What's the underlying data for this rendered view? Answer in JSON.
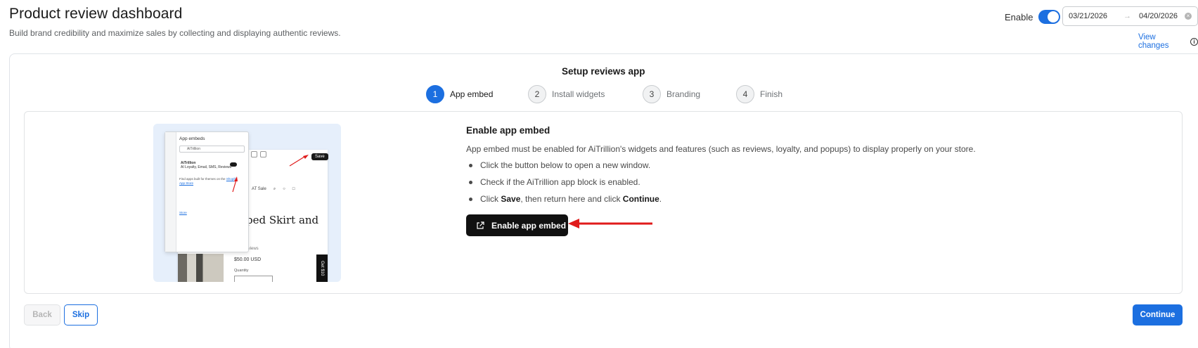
{
  "header": {
    "title": "Product review dashboard",
    "subtitle": "Build brand credibility and maximize sales by collecting and displaying authentic reviews.",
    "enable_label": "Enable",
    "enabled": true,
    "date_start": "03/21/2026",
    "date_end": "04/20/2026",
    "date_arrow": "→",
    "view_changes": "View changes"
  },
  "setup": {
    "title": "Setup reviews app",
    "steps": [
      {
        "num": "1",
        "label": "App embed",
        "active": true
      },
      {
        "num": "2",
        "label": "Install widgets",
        "active": false
      },
      {
        "num": "3",
        "label": "Branding",
        "active": false
      },
      {
        "num": "4",
        "label": "Finish",
        "active": false
      }
    ]
  },
  "illustration": {
    "panel_title": "App embeds",
    "search_text": "AiTrillion",
    "item_title": "AiTrillion",
    "item_sub": "AI Loyalty, Email, SMS, Reviews",
    "note": "Find apps built for themes on the",
    "note_link": "Shopify App Store",
    "panel_link": "Store",
    "save": "Save",
    "nav_item_1": "age",
    "nav_item_2": "AT Sale",
    "product_heading_1": "riped Skirt and",
    "product_heading_2": "p",
    "reviews": "No reviews",
    "price": "$50.00 USD",
    "quantity": "Quantity",
    "side_tab": "Get $10"
  },
  "content": {
    "title": "Enable app embed",
    "description": "App embed must be enabled for AiTrillion's widgets and features (such as reviews, loyalty, and popups) to display properly on your store.",
    "bullet_1": "Click the button below to open a new window.",
    "bullet_2": "Check if the AiTrillion app block is enabled.",
    "bullet_3_a": "Click ",
    "bullet_3_b": "Save",
    "bullet_3_c": ", then return here and click ",
    "bullet_3_d": "Continue",
    "bullet_3_e": ".",
    "button_label": "Enable app embed"
  },
  "footer": {
    "back": "Back",
    "skip": "Skip",
    "continue": "Continue"
  },
  "colors": {
    "accent": "#1c6fe0",
    "annotation_arrow": "#e01b1b",
    "primary_dark": "#111111"
  }
}
